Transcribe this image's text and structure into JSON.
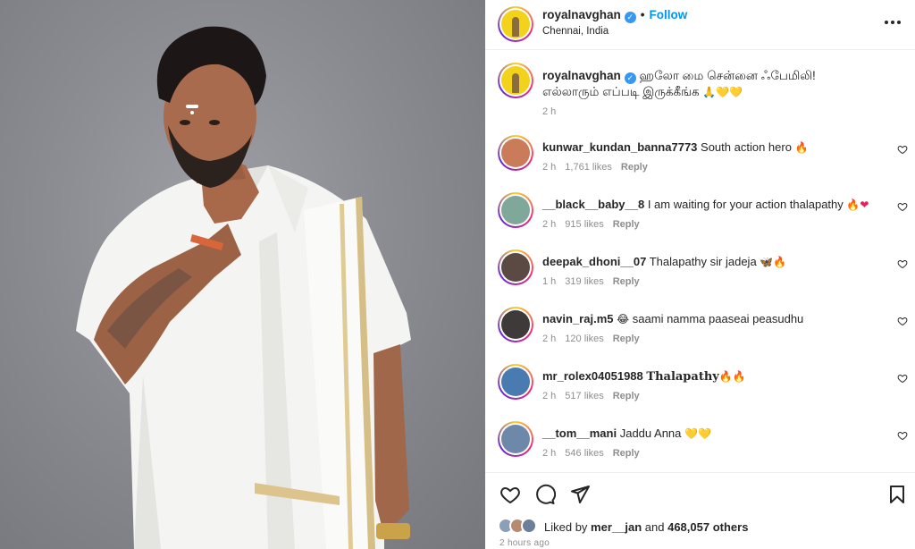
{
  "post": {
    "username": "royalnavghan",
    "verified_mark": "✓",
    "follow_label": "Follow",
    "location": "Chennai, India",
    "more_icon": "more-horizontal-icon"
  },
  "caption": {
    "username": "royalnavghan",
    "text_line1": "ஹலோ மை சென்னை ஃபேமிலி!",
    "text_line2": "எல்லாரும் எப்படி இருக்கீங்க",
    "emojis": "🙏💛💛",
    "time": "2 h"
  },
  "comments": [
    {
      "user": "kunwar_kundan_banna7773",
      "text": "South action hero",
      "emoji": "🔥",
      "time": "2 h",
      "likes": "1,761 likes",
      "reply": "Reply",
      "avatar_color": "#c97b5a"
    },
    {
      "user": "__black__baby__8",
      "text": "I am waiting for your action thalapathy",
      "emoji": "🔥❤",
      "time": "2 h",
      "likes": "915 likes",
      "reply": "Reply",
      "avatar_color": "#7fa89a"
    },
    {
      "user": "deepak_dhoni__07",
      "text": "Thalapathy sir jadeja",
      "emoji": "🦋🔥",
      "time": "1 h",
      "likes": "319 likes",
      "reply": "Reply",
      "avatar_color": "#5b4a44"
    },
    {
      "user": "navin_raj.m5",
      "text": "saami namma paaseai peasudhu",
      "emoji_prefix": "😂",
      "time": "2 h",
      "likes": "120 likes",
      "reply": "Reply",
      "avatar_color": "#3e3a3a"
    },
    {
      "user": "mr_rolex04051988",
      "text": "Thalapathy",
      "emoji": "🔥🔥",
      "time": "2 h",
      "likes": "517 likes",
      "reply": "Reply",
      "avatar_color": "#4a7bb0"
    },
    {
      "user": "__tom__mani",
      "text": "Jaddu Anna",
      "emoji": "💛💛",
      "time": "2 h",
      "likes": "546 likes",
      "reply": "Reply",
      "avatar_color": "#6d88a8"
    }
  ],
  "actions": {
    "like_icon": "heart-outline-icon",
    "comment_icon": "comment-bubble-icon",
    "share_icon": "send-paper-plane-icon",
    "save_icon": "bookmark-icon"
  },
  "likes_summary": {
    "prefix": "Liked by ",
    "user": "mer__jan",
    "middle": " and ",
    "count": "468,057 others"
  },
  "posted_ago": "2 hours ago",
  "colors": {
    "accent": "#0095f6",
    "verified": "#3897f0",
    "muted_text": "#8e8e8e"
  }
}
